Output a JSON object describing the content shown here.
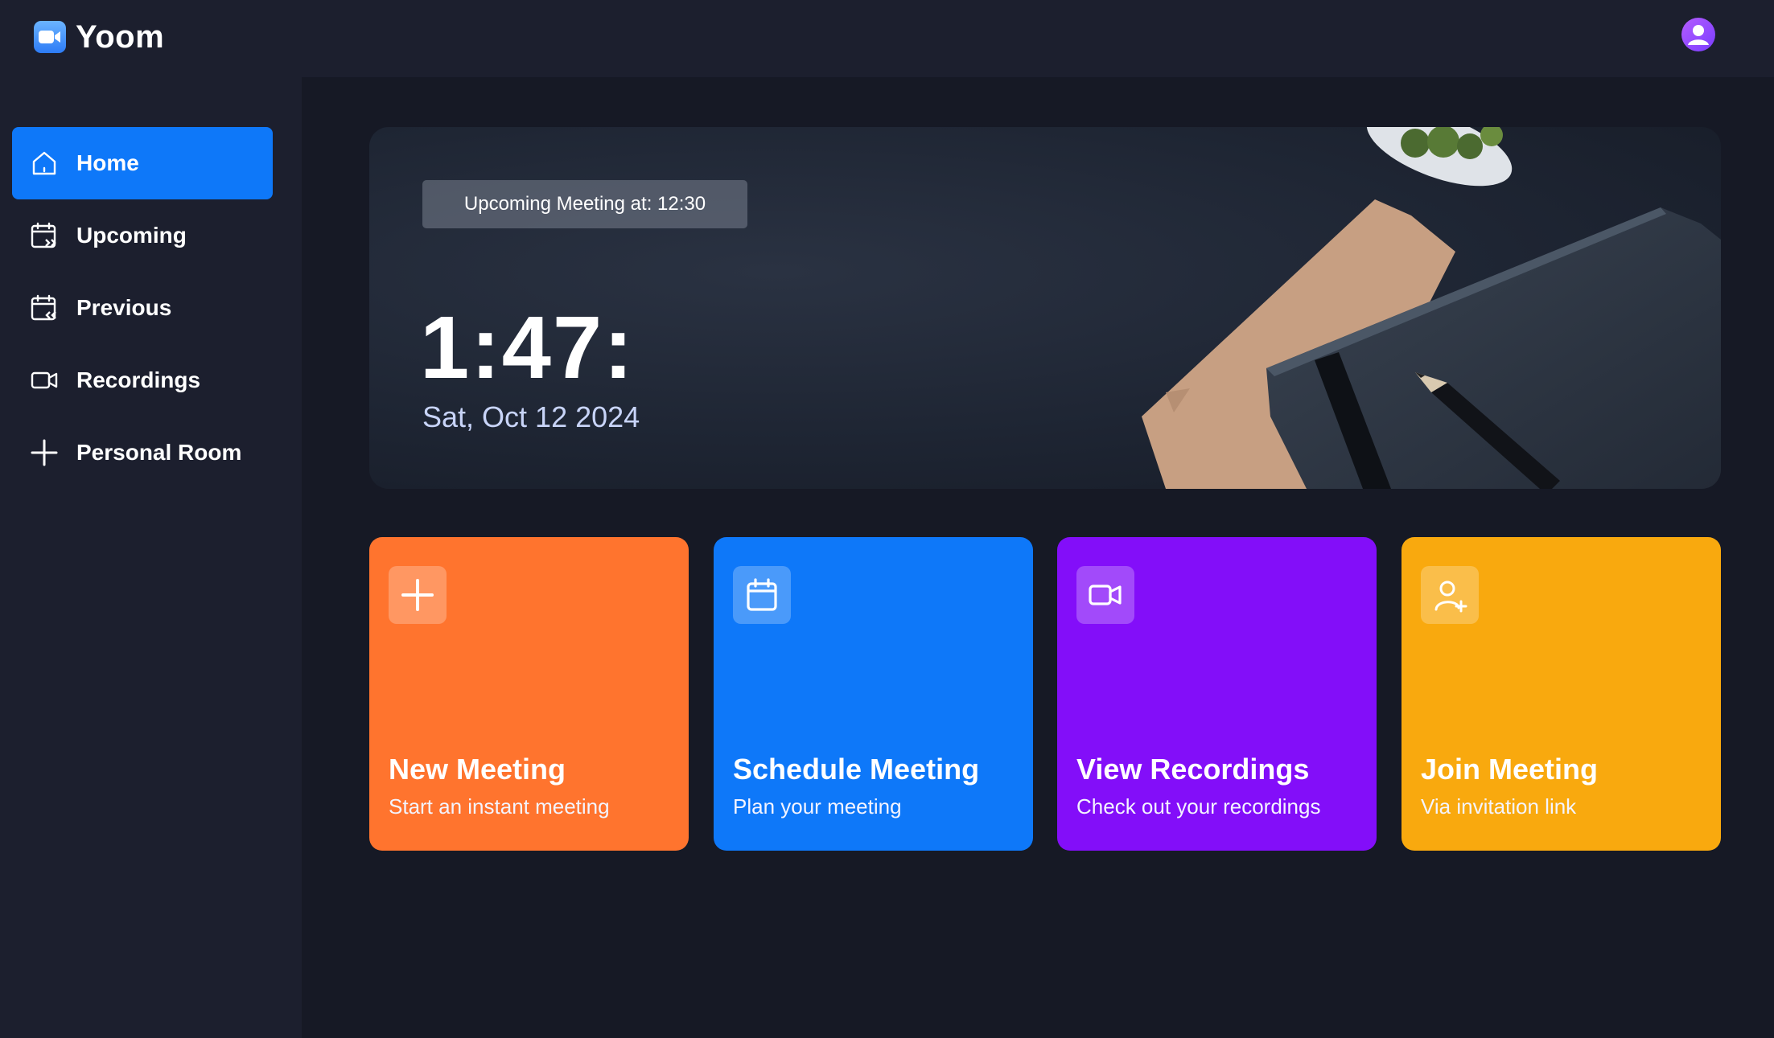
{
  "app": {
    "name": "Yoom"
  },
  "sidebar": {
    "items": [
      {
        "label": "Home",
        "icon": "home-icon",
        "active": true
      },
      {
        "label": "Upcoming",
        "icon": "calendar-upcoming-icon",
        "active": false
      },
      {
        "label": "Previous",
        "icon": "calendar-previous-icon",
        "active": false
      },
      {
        "label": "Recordings",
        "icon": "video-icon",
        "active": false
      },
      {
        "label": "Personal Room",
        "icon": "plus-icon",
        "active": false
      }
    ]
  },
  "hero": {
    "upcoming_text": "Upcoming Meeting at: 12:30",
    "time": "1:47:",
    "date": "Sat, Oct 12 2024"
  },
  "cards": [
    {
      "title": "New Meeting",
      "subtitle": "Start an instant meeting",
      "icon": "plus-icon",
      "color": "#ff742e"
    },
    {
      "title": "Schedule Meeting",
      "subtitle": "Plan your meeting",
      "icon": "calendar-icon",
      "color": "#0e78f9"
    },
    {
      "title": "View Recordings",
      "subtitle": "Check out your recordings",
      "icon": "video-icon",
      "color": "#830ef9"
    },
    {
      "title": "Join Meeting",
      "subtitle": "Via invitation link",
      "icon": "user-plus-icon",
      "color": "#f9a90e"
    }
  ],
  "colors": {
    "background": "#161925",
    "panel": "#1c1f2e",
    "accent": "#0e78f9"
  }
}
